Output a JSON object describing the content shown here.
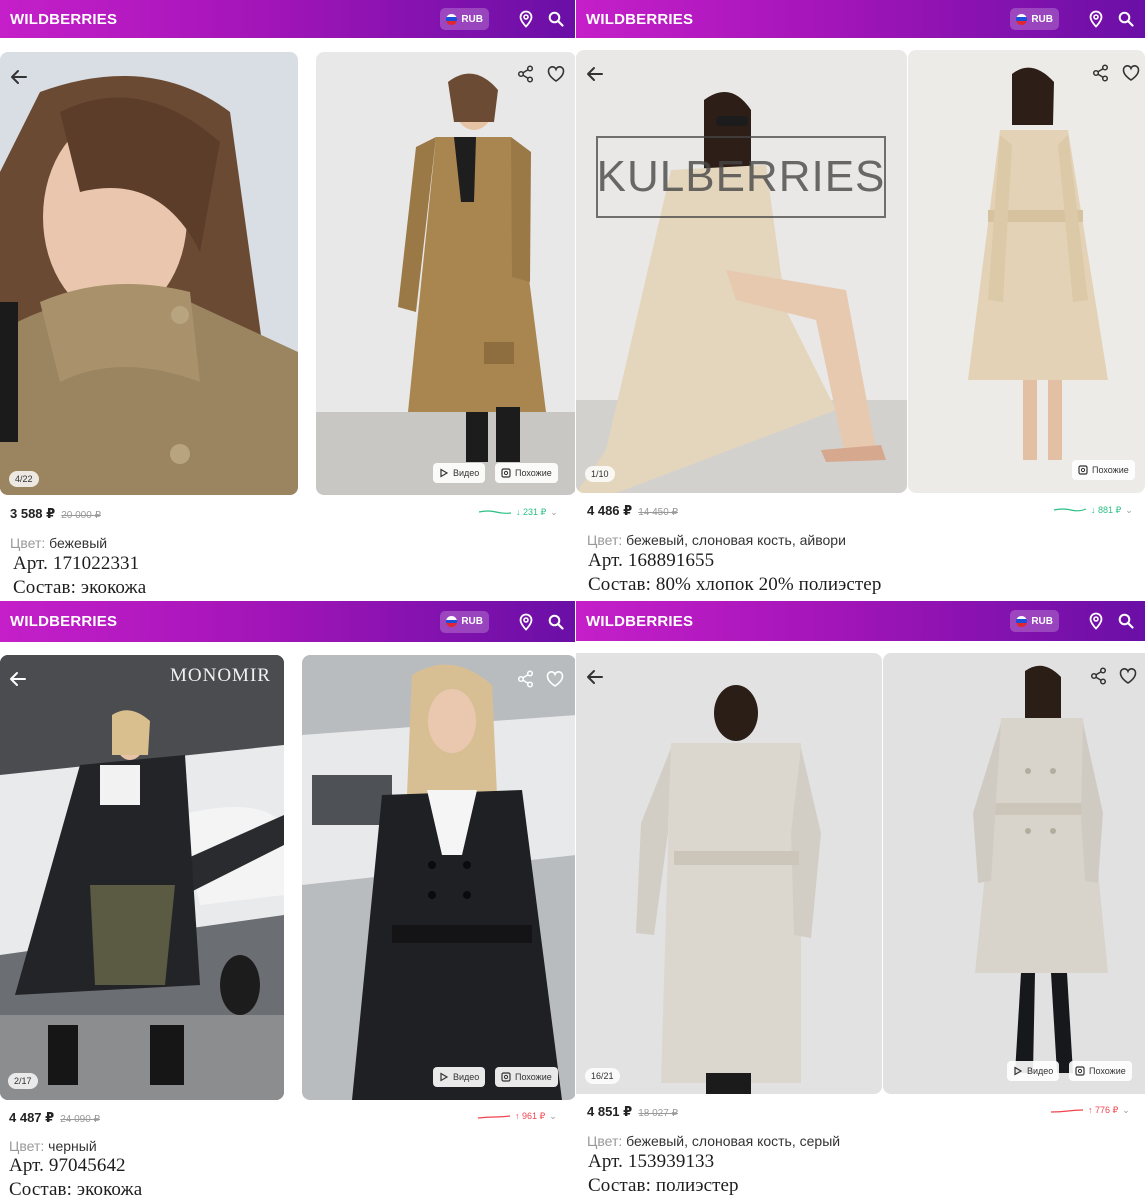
{
  "panels": [
    {
      "logo": "WILDBERRIES",
      "currency": "RUB",
      "counter": "4/22",
      "chips": [
        "Видео",
        "Похожие"
      ],
      "price": "3 588 ₽",
      "old_price": "20 000 ₽",
      "trend": {
        "direction": "down",
        "value": "↓ 231 ₽",
        "color": "#2bbf84"
      },
      "color_label": "Цвет:",
      "color_value": "бежевый",
      "article": "Арт. 171022331",
      "composition": "Состав: экокожа"
    },
    {
      "logo": "WILDBERRIES",
      "currency": "RUB",
      "counter": "1/10",
      "chips": [
        "Похожие"
      ],
      "watermark": "KULBERRIES",
      "price": "4 486 ₽",
      "old_price": "14 450 ₽",
      "trend": {
        "direction": "down",
        "value": "↓ 881 ₽",
        "color": "#2bbf84"
      },
      "color_label": "Цвет:",
      "color_value": "бежевый, слоновая кость, айвори",
      "article": "Арт. 168891655",
      "composition": "Состав: 80% хлопок 20% полиэстер"
    },
    {
      "logo": "WILDBERRIES",
      "currency": "RUB",
      "counter": "2/17",
      "chips": [
        "Видео",
        "Похожие"
      ],
      "watermark": "MONOMIR",
      "price": "4 487 ₽",
      "old_price": "24 090 ₽",
      "trend": {
        "direction": "up",
        "value": "↑ 961 ₽",
        "color": "#f0434e"
      },
      "color_label": "Цвет:",
      "color_value": "черный",
      "article": "Арт. 97045642",
      "composition": "Состав: экокожа"
    },
    {
      "logo": "WILDBERRIES",
      "currency": "RUB",
      "counter": "16/21",
      "chips": [
        "Видео",
        "Похожие"
      ],
      "price": "4 851 ₽",
      "old_price": "18 027 ₽",
      "trend": {
        "direction": "up",
        "value": "↑ 776 ₽",
        "color": "#f0434e"
      },
      "color_label": "Цвет:",
      "color_value": "бежевый, слоновая кость, серый",
      "article": "Арт. 153939133",
      "composition": "Состав: полиэстер"
    }
  ],
  "colors": {
    "bar_start": "#c51fc9",
    "bar_end": "#6a0fa6",
    "trend_down": "#2bbf84",
    "trend_up": "#f0434e"
  },
  "icons": [
    "arrow-left-icon",
    "share-icon",
    "heart-icon",
    "location-pin-icon",
    "search-icon",
    "play-icon",
    "similar-icon"
  ]
}
